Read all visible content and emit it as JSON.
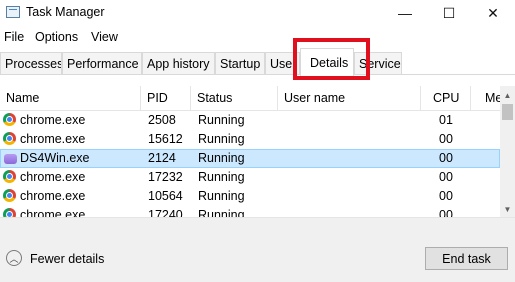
{
  "window": {
    "title": "Task Manager",
    "minimize": "—",
    "maximize": "☐",
    "close": "✕"
  },
  "menu": [
    "File",
    "Options",
    "View"
  ],
  "tabs": [
    "Processes",
    "Performance",
    "App history",
    "Startup",
    "User",
    "Details",
    "Services"
  ],
  "active_tab": "Details",
  "highlight_color": "#e0101e",
  "columns": [
    "Name",
    "PID",
    "Status",
    "User name",
    "CPU",
    "Me"
  ],
  "rows": [
    {
      "name": "chrome.exe",
      "pid": "2508",
      "status": "Running",
      "user": "",
      "cpu": "01",
      "icon": "chrome-icon"
    },
    {
      "name": "chrome.exe",
      "pid": "15612",
      "status": "Running",
      "user": "",
      "cpu": "00",
      "icon": "chrome-icon"
    },
    {
      "name": "DS4Win.exe",
      "pid": "2124",
      "status": "Running",
      "user": "",
      "cpu": "00",
      "icon": "gamepad-icon",
      "selected": true
    },
    {
      "name": "chrome.exe",
      "pid": "17232",
      "status": "Running",
      "user": "",
      "cpu": "00",
      "icon": "chrome-icon"
    },
    {
      "name": "chrome.exe",
      "pid": "10564",
      "status": "Running",
      "user": "",
      "cpu": "00",
      "icon": "chrome-icon"
    },
    {
      "name": "chrome.exe",
      "pid": "17240",
      "status": "Running",
      "user": "",
      "cpu": "00",
      "icon": "chrome-icon"
    }
  ],
  "footer": {
    "fewer_details": "Fewer details",
    "end_task": "End task"
  }
}
